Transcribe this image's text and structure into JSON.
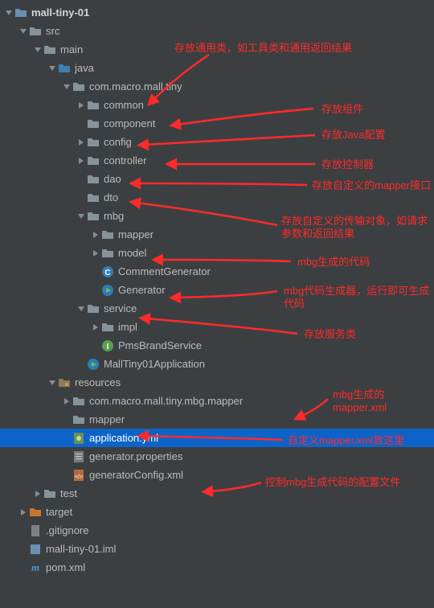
{
  "tree": {
    "root": "mall-tiny-01",
    "src": "src",
    "main": "main",
    "java": "java",
    "pkg": "com.macro.mall.tiny",
    "common": "common",
    "component": "component",
    "config": "config",
    "controller": "controller",
    "dao": "dao",
    "dto": "dto",
    "mbg": "mbg",
    "mapper": "mapper",
    "model": "model",
    "commentGenerator": "CommentGenerator",
    "generator": "Generator",
    "service": "service",
    "impl": "impl",
    "pmsBrandService": "PmsBrandService",
    "mallTinyApp": "MallTiny01Application",
    "resources": "resources",
    "resPkg": "com.macro.mall.tiny.mbg.mapper",
    "resMapper": "mapper",
    "appYml": "application.yml",
    "genProps": "generator.properties",
    "genConfig": "generatorConfig.xml",
    "test": "test",
    "target": "target",
    "gitignore": ".gitignore",
    "iml": "mall-tiny-01.iml",
    "pom": "pom.xml"
  },
  "annotations": {
    "common": "存放通用类，如工具类和通用返回结果",
    "component": "存放组件",
    "config": "存放Java配置",
    "controller": "存放控制器",
    "dao": "存放自定义的mapper接口",
    "dto": "存放自定义的传输对象，如请求参数和返回结果",
    "mbg": "mbg生成的代码",
    "generator": "mbg代码生成器，运行即可生成代码",
    "service": "存放服务类",
    "resPkg": "mbg生成的mapper.xml",
    "resMapper": "自定义mapper.xml放这里",
    "genConfig": "控制mbg生成代码的配置文件"
  }
}
